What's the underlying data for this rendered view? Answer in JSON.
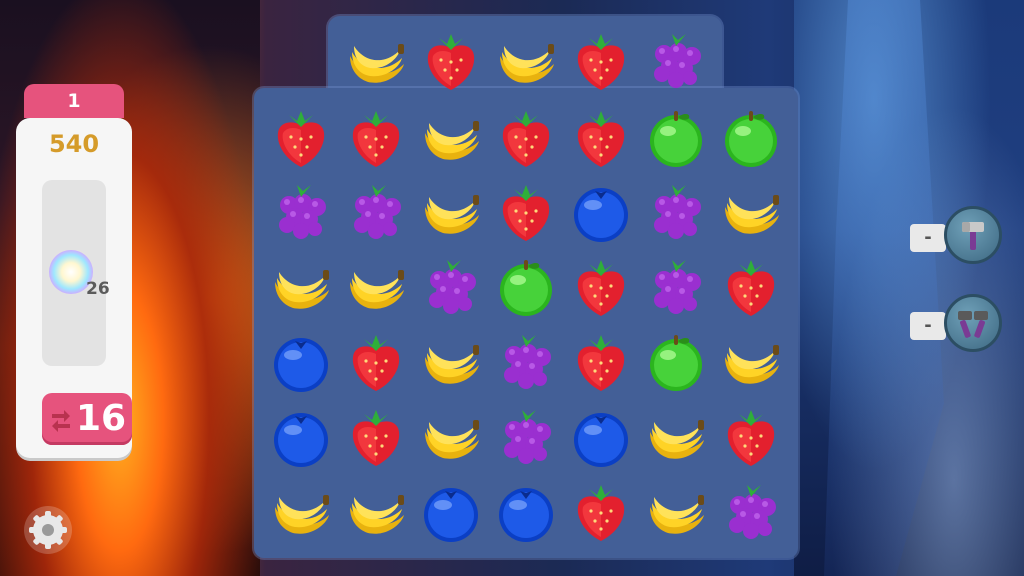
{
  "level": "1",
  "score": "540",
  "goal": {
    "icon": "rainbow-orb-icon",
    "count": "26"
  },
  "moves": "16",
  "boosters": [
    {
      "name": "hammer-booster",
      "count": "-"
    },
    {
      "name": "double-hammer-booster",
      "count": "-"
    }
  ],
  "board": {
    "cols": 7,
    "rows": 7,
    "grid": [
      [
        null,
        "banana",
        "strawberry",
        "banana",
        "strawberry",
        "grape",
        null
      ],
      [
        "strawberry",
        "strawberry",
        "banana",
        "strawberry",
        "strawberry",
        "apple",
        "apple"
      ],
      [
        "grape",
        "grape",
        "banana",
        "strawberry",
        "blueberry",
        "grape",
        "banana"
      ],
      [
        "banana",
        "banana",
        "grape",
        "apple",
        "strawberry",
        "grape",
        "strawberry"
      ],
      [
        "blueberry",
        "strawberry",
        "banana",
        "grape",
        "strawberry",
        "apple",
        "banana"
      ],
      [
        "blueberry",
        "strawberry",
        "banana",
        "grape",
        "blueberry",
        "banana",
        "strawberry"
      ],
      [
        "banana",
        "banana",
        "blueberry",
        "blueberry",
        "strawberry",
        "banana",
        "grape"
      ]
    ]
  }
}
